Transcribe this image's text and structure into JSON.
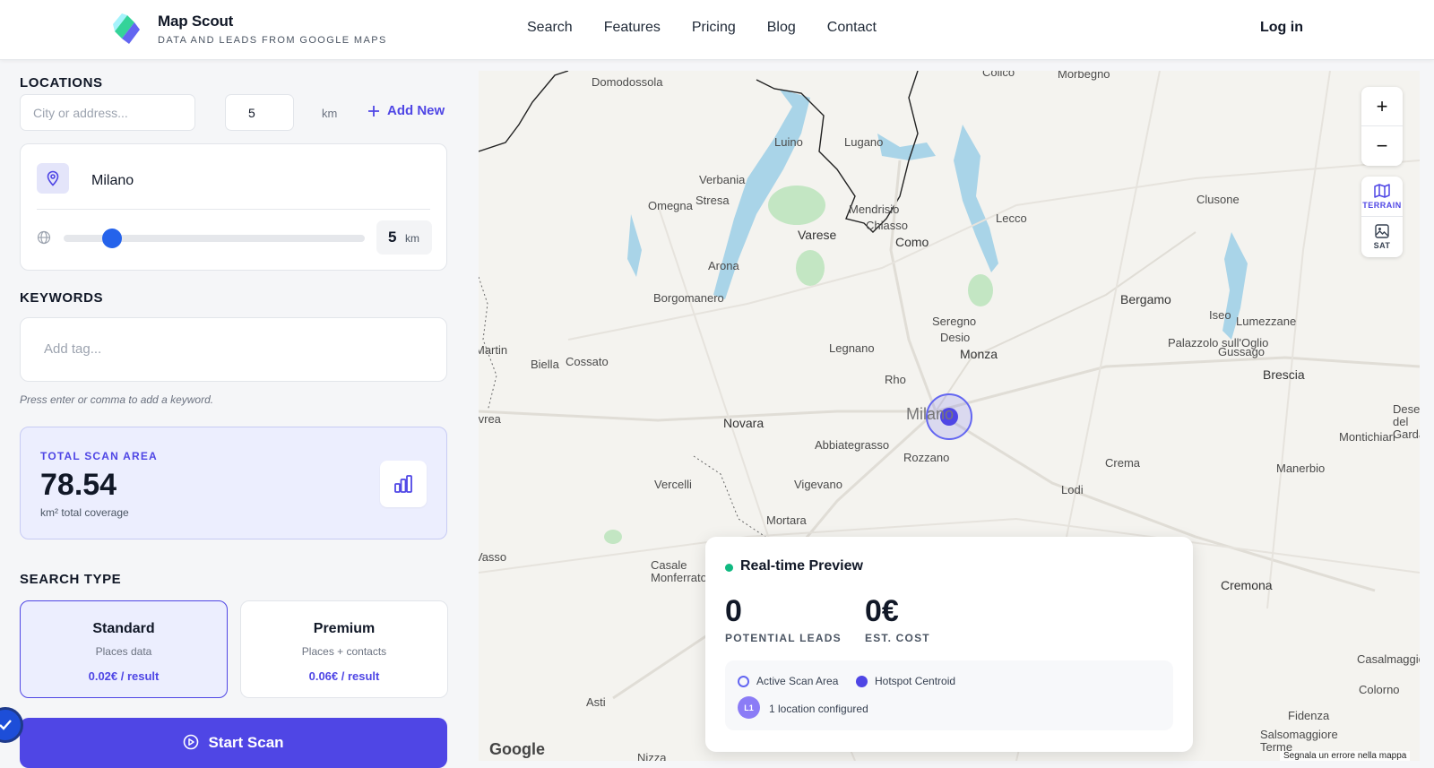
{
  "header": {
    "brand_name": "Map Scout",
    "brand_tagline": "DATA AND LEADS FROM GOOGLE MAPS",
    "nav": [
      "Search",
      "Features",
      "Pricing",
      "Blog",
      "Contact"
    ],
    "login": "Log in"
  },
  "locations": {
    "title": "LOCATIONS",
    "city_placeholder": "City or address...",
    "radius_value": "5",
    "radius_unit": "km",
    "add_new": "Add New",
    "items": [
      {
        "name": "Milano",
        "radius": "5",
        "unit": "km",
        "slider_fraction": 0.16
      }
    ]
  },
  "keywords": {
    "title": "KEYWORDS",
    "placeholder": "Add tag...",
    "hint": "Press enter or comma to add a keyword."
  },
  "scan_area": {
    "label": "TOTAL SCAN AREA",
    "value": "78.54",
    "sub": "km² total coverage"
  },
  "search_type": {
    "title": "SEARCH TYPE",
    "options": [
      {
        "name": "Standard",
        "desc": "Places data",
        "price": "0.02€ / result",
        "selected": true
      },
      {
        "name": "Premium",
        "desc": "Places + contacts",
        "price": "0.06€ / result",
        "selected": false
      }
    ]
  },
  "start_button": "Start Scan",
  "map": {
    "controls": {
      "zoom_in": "+",
      "zoom_out": "−",
      "terrain": "TERRAIN",
      "sat": "SAT"
    },
    "attribution": "Google",
    "report_error": "Segnala un errore nella mappa",
    "labels": [
      "Domodossola",
      "Colico",
      "Morbegno",
      "Luino",
      "Lugano",
      "Verbania",
      "Omegna",
      "Stresa",
      "Mendrisio",
      "Chiasso",
      "Varese",
      "Como",
      "Lecco",
      "Clusone",
      "Arona",
      "Borgomanero",
      "Bergamo",
      "Seregno",
      "Desio",
      "Monza",
      "Lumezzane",
      "Iseo",
      "Palazzolo sull'Oglio",
      "Gussago",
      "Brescia",
      "Legnano",
      "Biella",
      "Cossato",
      "Rho",
      "Milano",
      "Novara",
      "Abbiategrasso",
      "Rozzano",
      "Crema",
      "Montichiari",
      "Manerbio",
      "Vercelli",
      "Vigevano",
      "Lodi",
      "Mortara",
      "Casale Monferrato",
      "Cremona",
      "Casalmaggiore",
      "Colorno",
      "Fidenza",
      "Salsomaggiore Terme",
      "Asti",
      "Nizza",
      "Desenzano del Garda",
      "Vasso",
      "Ivrea",
      "Martin"
    ]
  },
  "preview": {
    "title": "Real-time Preview",
    "leads_value": "0",
    "leads_label": "POTENTIAL LEADS",
    "cost_value": "0€",
    "cost_label": "EST. COST",
    "legend_active": "Active Scan Area",
    "legend_hotspot": "Hotspot Centroid",
    "avatar": "L1",
    "locations_text": "1 location configured"
  },
  "colors": {
    "accent": "#4f46e5",
    "slider": "#2563eb",
    "live": "#10b981"
  }
}
